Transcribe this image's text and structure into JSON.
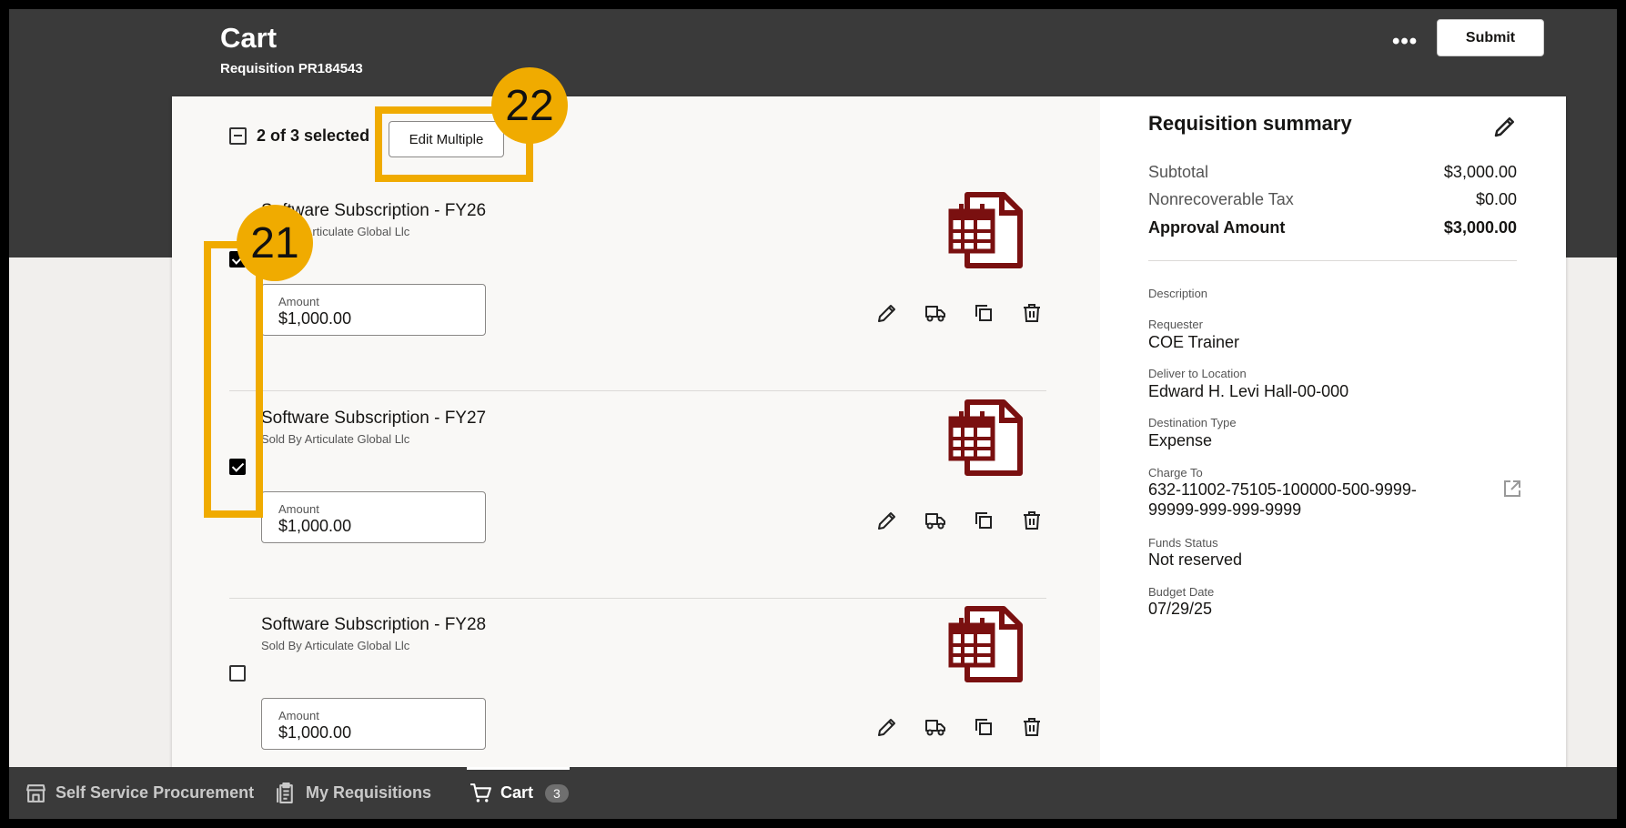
{
  "header": {
    "title": "Cart",
    "subtitle": "Requisition PR184543",
    "more_label": "•••",
    "submit_label": "Submit"
  },
  "selection": {
    "label": "2 of 3 selected",
    "edit_multiple_label": "Edit Multiple"
  },
  "items": [
    {
      "title": "Software Subscription - FY26",
      "seller": "Sold By Articulate Global Llc",
      "amount_label": "Amount",
      "amount": "$1,000.00",
      "checked": true
    },
    {
      "title": "Software Subscription - FY27",
      "seller": "Sold By Articulate Global Llc",
      "amount_label": "Amount",
      "amount": "$1,000.00",
      "checked": true
    },
    {
      "title": "Software Subscription - FY28",
      "seller": "Sold By Articulate Global Llc",
      "amount_label": "Amount",
      "amount": "$1,000.00",
      "checked": false
    }
  ],
  "summary": {
    "title": "Requisition summary",
    "subtotal_label": "Subtotal",
    "subtotal": "$3,000.00",
    "tax_label": "Nonrecoverable Tax",
    "tax": "$0.00",
    "approval_label": "Approval Amount",
    "approval": "$3,000.00",
    "description_label": "Description",
    "requester_label": "Requester",
    "requester": "COE Trainer",
    "deliver_label": "Deliver to Location",
    "deliver": "Edward H. Levi Hall-00-000",
    "dest_label": "Destination Type",
    "dest": "Expense",
    "charge_label": "Charge To",
    "charge_line1": "632-11002-75105-100000-500-9999-",
    "charge_line2": "99999-999-999-9999",
    "funds_label": "Funds Status",
    "funds": "Not reserved",
    "budget_label": "Budget Date",
    "budget": "07/29/25"
  },
  "nav": {
    "self_service": "Self Service Procurement",
    "my_requisitions": "My Requisitions",
    "cart": "Cart",
    "cart_count": "3"
  },
  "callouts": {
    "first": "21",
    "second": "22"
  },
  "colors": {
    "header_bg": "#3a3a3a",
    "doc_icon": "#7a1010",
    "callout": "#f0ab00"
  }
}
